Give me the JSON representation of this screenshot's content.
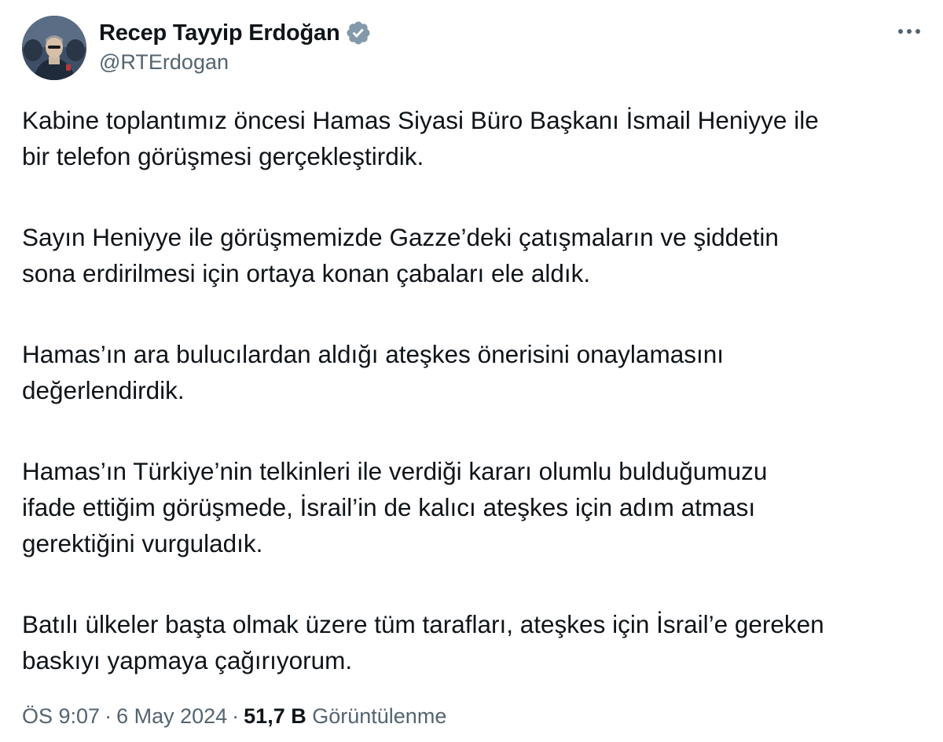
{
  "author": {
    "display_name": "Recep Tayyip Erdoğan",
    "handle": "@RTErdogan",
    "verified": true,
    "verified_color": "#829aab"
  },
  "tweet": {
    "paragraphs": [
      [
        "Kabine toplantımız öncesi Hamas Siyasi Büro Başkanı İsmail Heniyye ile",
        "bir telefon görüşmesi gerçekleştirdik."
      ],
      [
        "Sayın Heniyye ile görüşmemizde Gazze’deki çatışmaların ve şiddetin",
        "sona erdirilmesi için ortaya konan çabaları ele aldık."
      ],
      [
        "Hamas’ın ara bulucılardan aldığı ateşkes önerisini onaylamasını",
        "değerlendirdik."
      ],
      [
        "Hamas’ın Türkiye’nin telkinleri ile verdiği kararı olumlu bulduğumuzu",
        "ifade ettiğim görüşmede, İsrail’in de kalıcı ateşkes için adım atması",
        "gerektiğini vurguladık."
      ],
      [
        "Batılı ülkeler başta olmak üzere tüm tarafları, ateşkes için İsrail’e gereken",
        "baskıyı yapmaya çağırıyorum."
      ]
    ]
  },
  "meta": {
    "time": "ÖS 9:07",
    "separator": "·",
    "date": "6 May 2024",
    "views_count": "51,7 B",
    "views_label": "Görüntülenme"
  },
  "icons": {
    "more": "more-horizontal-icon",
    "verified": "verified-badge-icon"
  }
}
